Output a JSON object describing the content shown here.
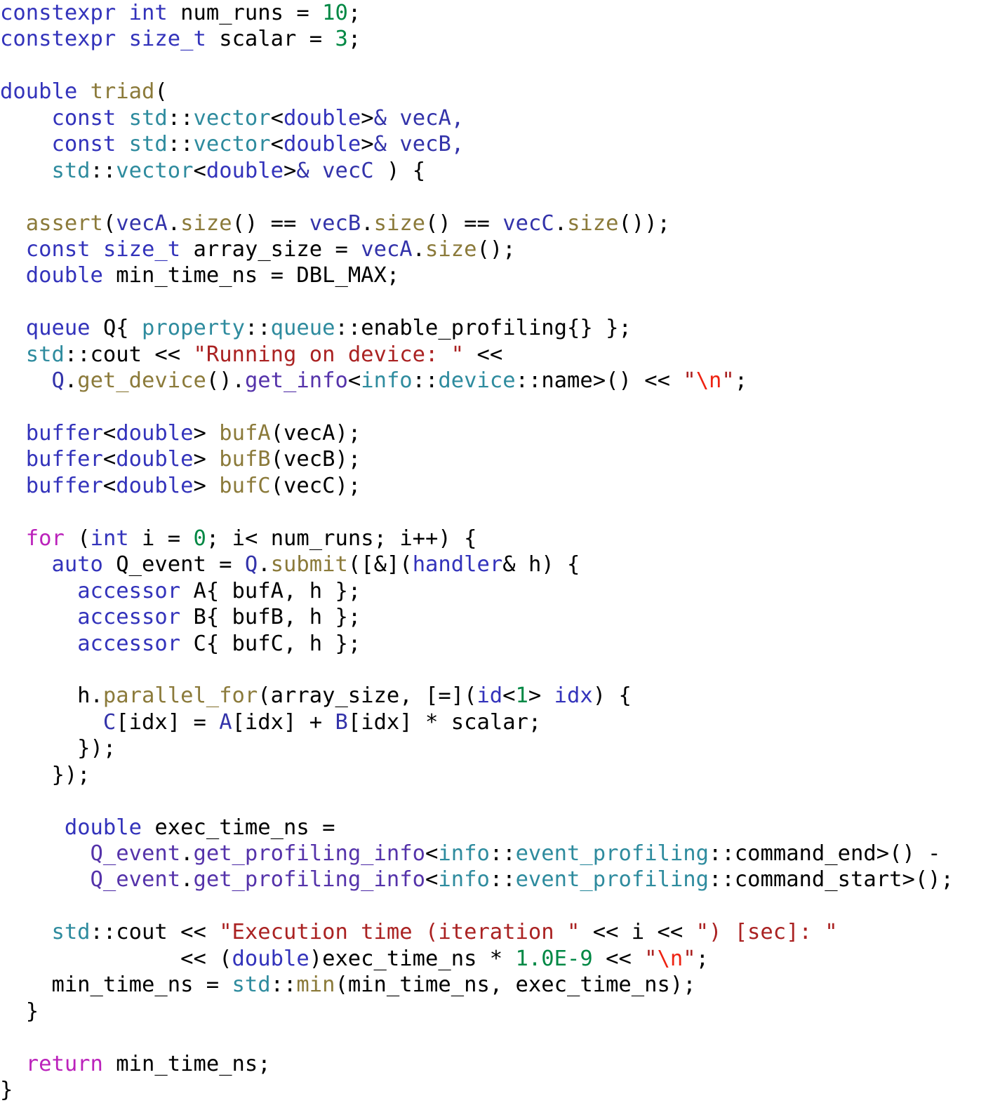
{
  "meta": {
    "language": "C++ (SYCL)",
    "background_color": "#ffffff",
    "font_size_px": 30.5,
    "line_height_px": 37.45
  },
  "palette": {
    "plain": "#000000",
    "type_keyword": "#3333bb",
    "control_keyword": "#bb22bb",
    "number": "#008844",
    "string": "#aa2222",
    "escape": "#ee2211",
    "function": "#8b7a3a",
    "namespace": "#2e8b9e",
    "variable": "#3333aa",
    "member": "#5533aa"
  },
  "code": {
    "lines": [
      "constexpr int num_runs = 10;",
      "constexpr size_t scalar = 3;",
      "",
      "double triad(",
      "    const std::vector<double>& vecA,",
      "    const std::vector<double>& vecB,",
      "    std::vector<double>& vecC ) {",
      "",
      "  assert(vecA.size() == vecB.size() == vecC.size());",
      "  const size_t array_size = vecA.size();",
      "  double min_time_ns = DBL_MAX;",
      "",
      "  queue Q{ property::queue::enable_profiling{} };",
      "  std::cout << \"Running on device: \" <<",
      "    Q.get_device().get_info<info::device::name>() << \"\\n\";",
      "",
      "  buffer<double> bufA(vecA);",
      "  buffer<double> bufB(vecB);",
      "  buffer<double> bufC(vecC);",
      "",
      "  for (int i = 0; i< num_runs; i++) {",
      "    auto Q_event = Q.submit([&](handler& h) {",
      "      accessor A{ bufA, h };",
      "      accessor B{ bufB, h };",
      "      accessor C{ bufC, h };",
      "",
      "      h.parallel_for(array_size, [=](id<1> idx) {",
      "        C[idx] = A[idx] + B[idx] * scalar;",
      "      });",
      "    });",
      "",
      "     double exec_time_ns =",
      "       Q_event.get_profiling_info<info::event_profiling::command_end>() -",
      "       Q_event.get_profiling_info<info::event_profiling::command_start>();",
      "",
      "    std::cout << \"Execution time (iteration \" << i << \") [sec]: \"",
      "              << (double)exec_time_ns * 1.0E-9 << \"\\n\";",
      "    min_time_ns = std::min(min_time_ns, exec_time_ns);",
      "  }",
      "",
      "  return min_time_ns;",
      "}"
    ]
  }
}
